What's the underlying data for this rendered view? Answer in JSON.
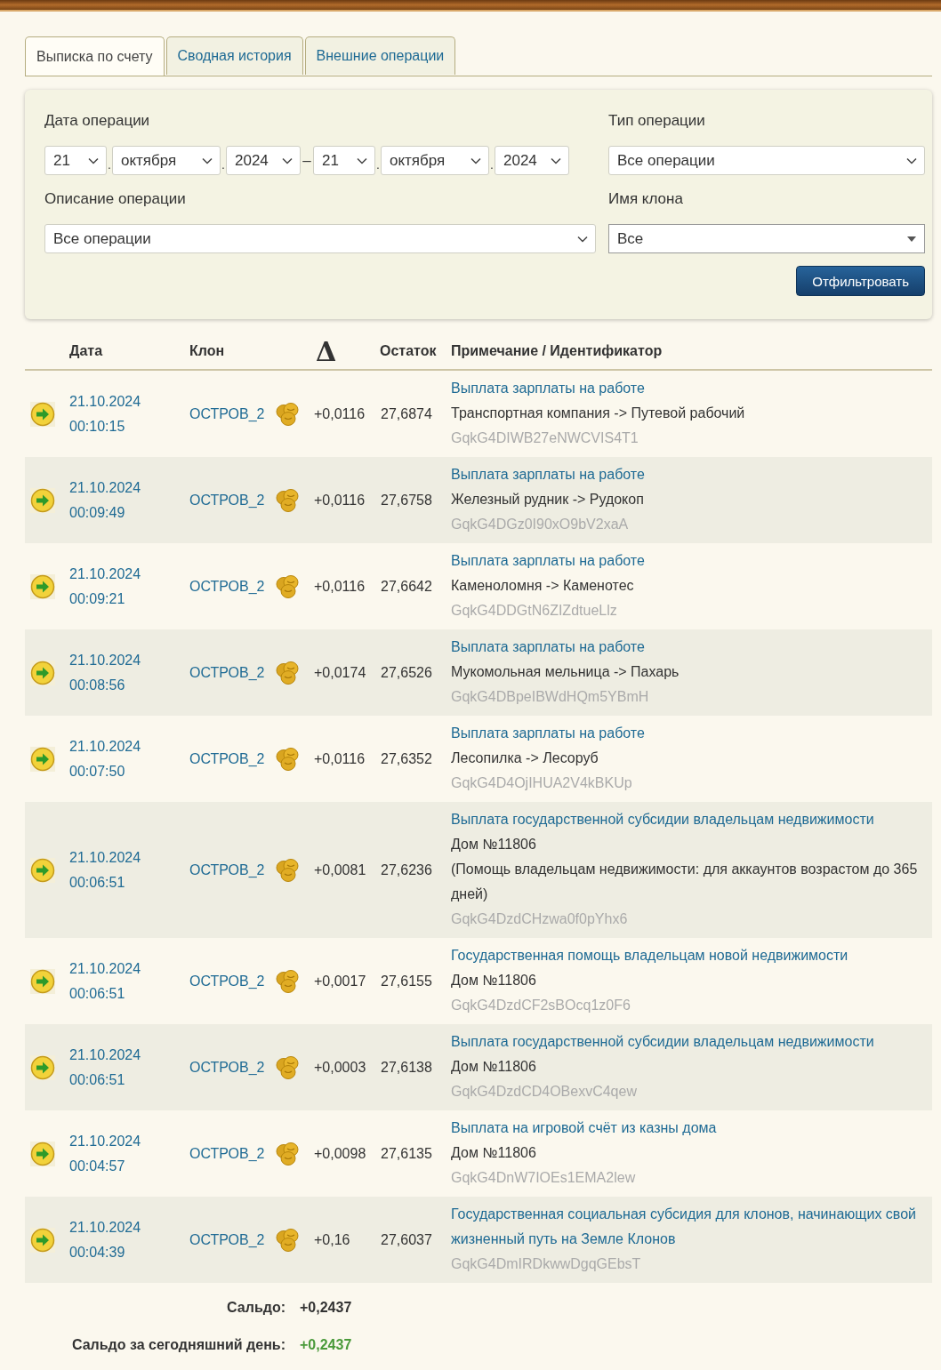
{
  "tabs": [
    {
      "label": "Выписка по счету",
      "selected": true
    },
    {
      "label": "Сводная история",
      "selected": false
    },
    {
      "label": "Внешние операции",
      "selected": false
    }
  ],
  "filter": {
    "date_label": "Дата операции",
    "date_from": [
      "21",
      "октября",
      "2024"
    ],
    "date_separator": ".",
    "range_dash": "–",
    "date_to": [
      "21",
      "октября",
      "2024"
    ],
    "type_label": "Тип операции",
    "type_select": {
      "value": "Все операции",
      "kind": "chevron"
    },
    "description_label": "Описание операции",
    "description_select": {
      "value": "Все операции",
      "kind": "chevron"
    },
    "clone_label": "Имя клона",
    "clone_select": {
      "value": "Все",
      "kind": "triangle"
    },
    "button": "Отфильтровать"
  },
  "table": {
    "columns": [
      "Дата",
      "Клон",
      "Δ",
      "Остаток",
      "Примечание / Идентификатор"
    ],
    "rows": [
      {
        "date": "21.10.2024",
        "time": "00:10:15",
        "clone": "ОСТРОВ_2",
        "delta": "+0,0116",
        "balance": "27,6874",
        "title": "Выплата зарплаты на работе",
        "details": [
          "Транспортная компания -> Путевой рабочий"
        ],
        "id": "GqkG4DIWB27eNWCVIS4T1"
      },
      {
        "date": "21.10.2024",
        "time": "00:09:49",
        "clone": "ОСТРОВ_2",
        "delta": "+0,0116",
        "balance": "27,6758",
        "title": "Выплата зарплаты на работе",
        "details": [
          "Железный рудник -> Рудокоп"
        ],
        "id": "GqkG4DGz0I90xO9bV2xaA"
      },
      {
        "date": "21.10.2024",
        "time": "00:09:21",
        "clone": "ОСТРОВ_2",
        "delta": "+0,0116",
        "balance": "27,6642",
        "title": "Выплата зарплаты на работе",
        "details": [
          "Каменоломня -> Каменотес"
        ],
        "id": "GqkG4DDGtN6ZIZdtueLlz"
      },
      {
        "date": "21.10.2024",
        "time": "00:08:56",
        "clone": "ОСТРОВ_2",
        "delta": "+0,0174",
        "balance": "27,6526",
        "title": "Выплата зарплаты на работе",
        "details": [
          "Мукомольная мельница -> Пахарь"
        ],
        "id": "GqkG4DBpeIBWdHQm5YBmH"
      },
      {
        "date": "21.10.2024",
        "time": "00:07:50",
        "clone": "ОСТРОВ_2",
        "delta": "+0,0116",
        "balance": "27,6352",
        "title": "Выплата зарплаты на работе",
        "details": [
          "Лесопилка -> Лесоруб"
        ],
        "id": "GqkG4D4OjIHUA2V4kBKUp"
      },
      {
        "date": "21.10.2024",
        "time": "00:06:51",
        "clone": "ОСТРОВ_2",
        "delta": "+0,0081",
        "balance": "27,6236",
        "title": "Выплата государственной субсидии владельцам недвижимости",
        "details": [
          "Дом №11806",
          "(Помощь владельцам недвижимости: для аккаунтов возрастом до 365 дней)"
        ],
        "id": "GqkG4DzdCHzwa0f0pYhx6"
      },
      {
        "date": "21.10.2024",
        "time": "00:06:51",
        "clone": "ОСТРОВ_2",
        "delta": "+0,0017",
        "balance": "27,6155",
        "title": "Государственная помощь владельцам новой недвижимости",
        "details": [
          "Дом №11806"
        ],
        "id": "GqkG4DzdCF2sBOcq1z0F6"
      },
      {
        "date": "21.10.2024",
        "time": "00:06:51",
        "clone": "ОСТРОВ_2",
        "delta": "+0,0003",
        "balance": "27,6138",
        "title": "Выплата государственной субсидии владельцам недвижимости",
        "details": [
          "Дом №11806"
        ],
        "id": "GqkG4DzdCD4OBexvC4qew"
      },
      {
        "date": "21.10.2024",
        "time": "00:04:57",
        "clone": "ОСТРОВ_2",
        "delta": "+0,0098",
        "balance": "27,6135",
        "title": "Выплата на игровой счёт из казны дома",
        "details": [
          "Дом №11806"
        ],
        "id": "GqkG4DnW7IOEs1EMA2lew"
      },
      {
        "date": "21.10.2024",
        "time": "00:04:39",
        "clone": "ОСТРОВ_2",
        "delta": "+0,16",
        "balance": "27,6037",
        "title": "Государственная социальная субсидия для клонов, начинающих свой жизненный путь на Земле Клонов",
        "details": [],
        "id": "GqkG4DmIRDkwwDgqGEbsT"
      }
    ]
  },
  "totals": [
    {
      "label": "Сальдо:",
      "value": "+0,2437",
      "positive": false
    },
    {
      "label": "Сальдо за сегодняшний день:",
      "value": "+0,2437",
      "positive": true
    }
  ]
}
